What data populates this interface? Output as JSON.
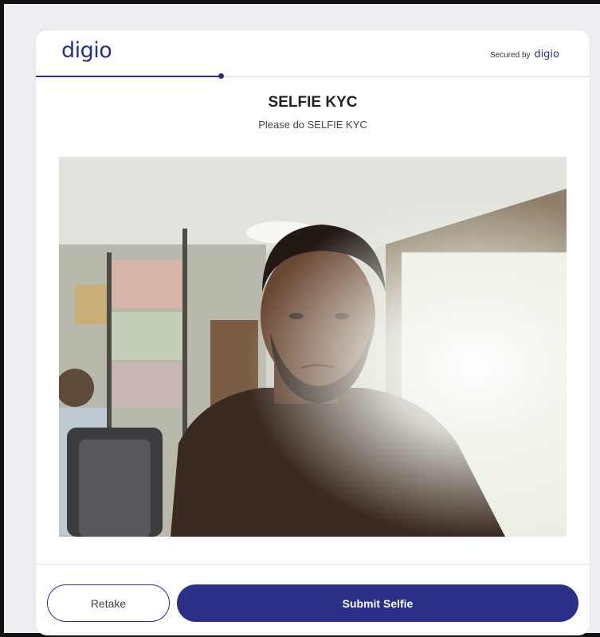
{
  "brand": {
    "logo_text": "digio",
    "secured_label": "Secured by",
    "secured_logo_text": "digio",
    "primary_color": "#2b2f86"
  },
  "page": {
    "title": "SELFIE KYC",
    "subtitle": "Please do SELFIE KYC"
  },
  "progress": {
    "fraction": 0.33
  },
  "actions": {
    "retake_label": "Retake",
    "submit_label": "Submit Selfie"
  }
}
